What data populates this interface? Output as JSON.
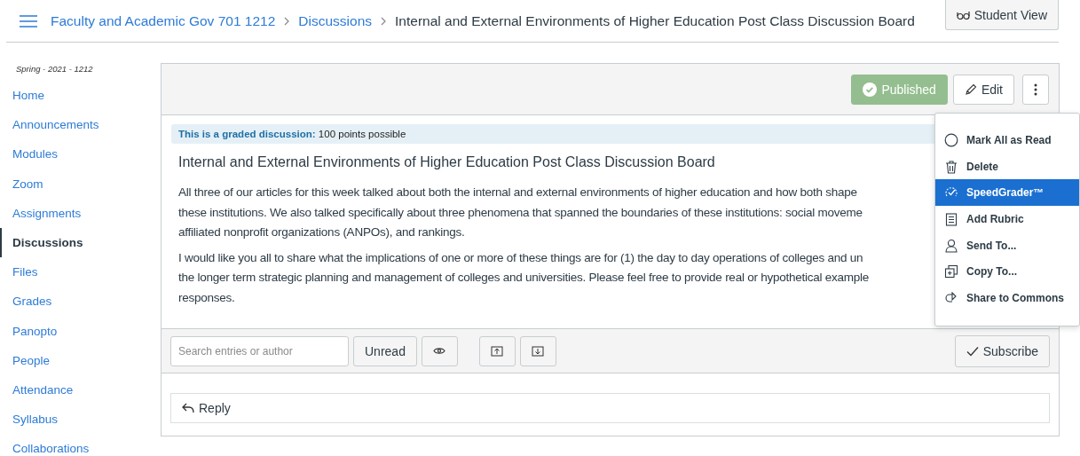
{
  "breadcrumbs": [
    {
      "label": "Faculty and Academic Gov 701 1212",
      "kind": "link"
    },
    {
      "label": "Discussions",
      "kind": "link"
    },
    {
      "label": "Internal and External Environments of Higher Education Post Class Discussion Board",
      "kind": "current"
    }
  ],
  "student_view_button": "Student View",
  "sidebar": {
    "term": "Spring - 2021 - 1212",
    "items": [
      {
        "label": "Home",
        "selected": false
      },
      {
        "label": "Announcements",
        "selected": false
      },
      {
        "label": "Modules",
        "selected": false
      },
      {
        "label": "Zoom",
        "selected": false
      },
      {
        "label": "Assignments",
        "selected": false
      },
      {
        "label": "Discussions",
        "selected": true
      },
      {
        "label": "Files",
        "selected": false
      },
      {
        "label": "Grades",
        "selected": false
      },
      {
        "label": "Panopto",
        "selected": false
      },
      {
        "label": "People",
        "selected": false
      },
      {
        "label": "Attendance",
        "selected": false
      },
      {
        "label": "Syllabus",
        "selected": false
      },
      {
        "label": "Collaborations",
        "selected": false
      }
    ]
  },
  "toolbar": {
    "published": {
      "label": "Published",
      "on": true
    },
    "edit_button": "Edit"
  },
  "graded_banner": "**This is a graded discussion:** 100 points possible",
  "discussion_title": "Internal and External Environments of Higher Education Post Class Discussion Board",
  "paragraphs": [
    [
      "All three of our articles for this week talked about both the internal and external environments of higher education and how both shape",
      "these institutions. We also talked specifically about three phenomena that spanned the boundaries of these institutions: social moveme",
      "affiliated nonprofit organizations (ANPOs), and rankings."
    ],
    [
      "I would like you all to share what the implications of one or more of these things are for (1) the day to day operations of colleges and un",
      "the longer term strategic planning and management of colleges and universities. Please feel free to provide real or hypothetical example",
      "responses."
    ]
  ],
  "menu": [
    {
      "label": "Mark All as Read",
      "kind": "circle",
      "selected": false
    },
    {
      "label": "Delete",
      "kind": "trash",
      "selected": false
    },
    {
      "label": "SpeedGrader™",
      "kind": "gauge",
      "selected": true
    },
    {
      "label": "Add Rubric",
      "kind": "rubric",
      "selected": false
    },
    {
      "label": "Send To...",
      "kind": "person",
      "selected": false
    },
    {
      "label": "Copy To...",
      "kind": "copy",
      "selected": false
    },
    {
      "label": "Share to Commons",
      "kind": "share",
      "selected": false
    }
  ],
  "search": {
    "placeholder": "Search entries or author"
  },
  "unread_button": "Unread",
  "subscribe_button": "Subscribe",
  "reply_button": "Reply"
}
